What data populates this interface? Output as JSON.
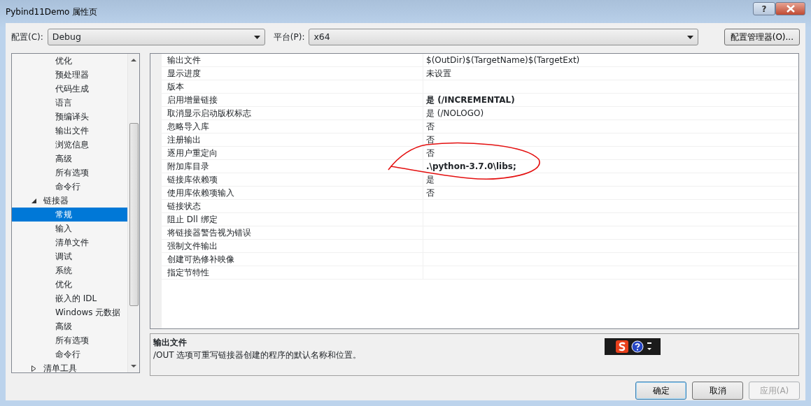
{
  "window": {
    "title": "Pybind11Demo 属性页",
    "help_button": "?"
  },
  "toolbar": {
    "config_label": "配置(C):",
    "config_value": "Debug",
    "platform_label": "平台(P):",
    "platform_value": "x64",
    "manager_button": "配置管理器(O)..."
  },
  "tree": {
    "scrolled_children": [
      {
        "label": "优化",
        "selected": false
      },
      {
        "label": "预处理器",
        "selected": false
      },
      {
        "label": "代码生成",
        "selected": false
      },
      {
        "label": "语言",
        "selected": false
      },
      {
        "label": "预编译头",
        "selected": false
      },
      {
        "label": "输出文件",
        "selected": false
      },
      {
        "label": "浏览信息",
        "selected": false
      },
      {
        "label": "高级",
        "selected": false
      },
      {
        "label": "所有选项",
        "selected": false
      },
      {
        "label": "命令行",
        "selected": false
      }
    ],
    "items": [
      {
        "label": "链接器",
        "expanded": true,
        "selected": false,
        "children": [
          {
            "label": "常规",
            "selected": true
          },
          {
            "label": "输入",
            "selected": false
          },
          {
            "label": "清单文件",
            "selected": false
          },
          {
            "label": "调试",
            "selected": false
          },
          {
            "label": "系统",
            "selected": false
          },
          {
            "label": "优化",
            "selected": false
          },
          {
            "label": "嵌入的 IDL",
            "selected": false
          },
          {
            "label": "Windows 元数据",
            "selected": false
          },
          {
            "label": "高级",
            "selected": false
          },
          {
            "label": "所有选项",
            "selected": false
          },
          {
            "label": "命令行",
            "selected": false
          }
        ]
      },
      {
        "label": "清单工具",
        "expanded": false,
        "selected": false
      }
    ]
  },
  "properties": [
    {
      "name": "输出文件",
      "value": "$(OutDir)$(TargetName)$(TargetExt)",
      "bold": false
    },
    {
      "name": "显示进度",
      "value": "未设置",
      "bold": false
    },
    {
      "name": "版本"
    },
    {
      "name": "启用增量链接",
      "value": "是 (/INCREMENTAL)",
      "bold": true
    },
    {
      "name": "取消显示启动版权标志",
      "value": "是 (/NOLOGO)",
      "bold": false
    },
    {
      "name": "忽略导入库",
      "value": "否",
      "bold": false
    },
    {
      "name": "注册输出",
      "value": "否",
      "bold": false
    },
    {
      "name": "逐用户重定向",
      "value": "否",
      "bold": false
    },
    {
      "name": "附加库目录",
      "value": ".\\python-3.7.0\\libs;",
      "bold": true
    },
    {
      "name": "链接库依赖项",
      "value": "是",
      "bold": false
    },
    {
      "name": "使用库依赖项输入",
      "value": "否",
      "bold": false
    },
    {
      "name": "链接状态"
    },
    {
      "name": "阻止 Dll 绑定"
    },
    {
      "name": "将链接器警告视为错误"
    },
    {
      "name": "强制文件输出"
    },
    {
      "name": "创建可热修补映像"
    },
    {
      "name": "指定节特性"
    }
  ],
  "description": {
    "title": "输出文件",
    "text": "/OUT 选项可重写链接器创建的程序的默认名称和位置。"
  },
  "buttons": [
    {
      "label": "确定",
      "disabled": false
    },
    {
      "label": "取消",
      "disabled": false
    },
    {
      "label": "应用(A)",
      "disabled": true
    }
  ]
}
